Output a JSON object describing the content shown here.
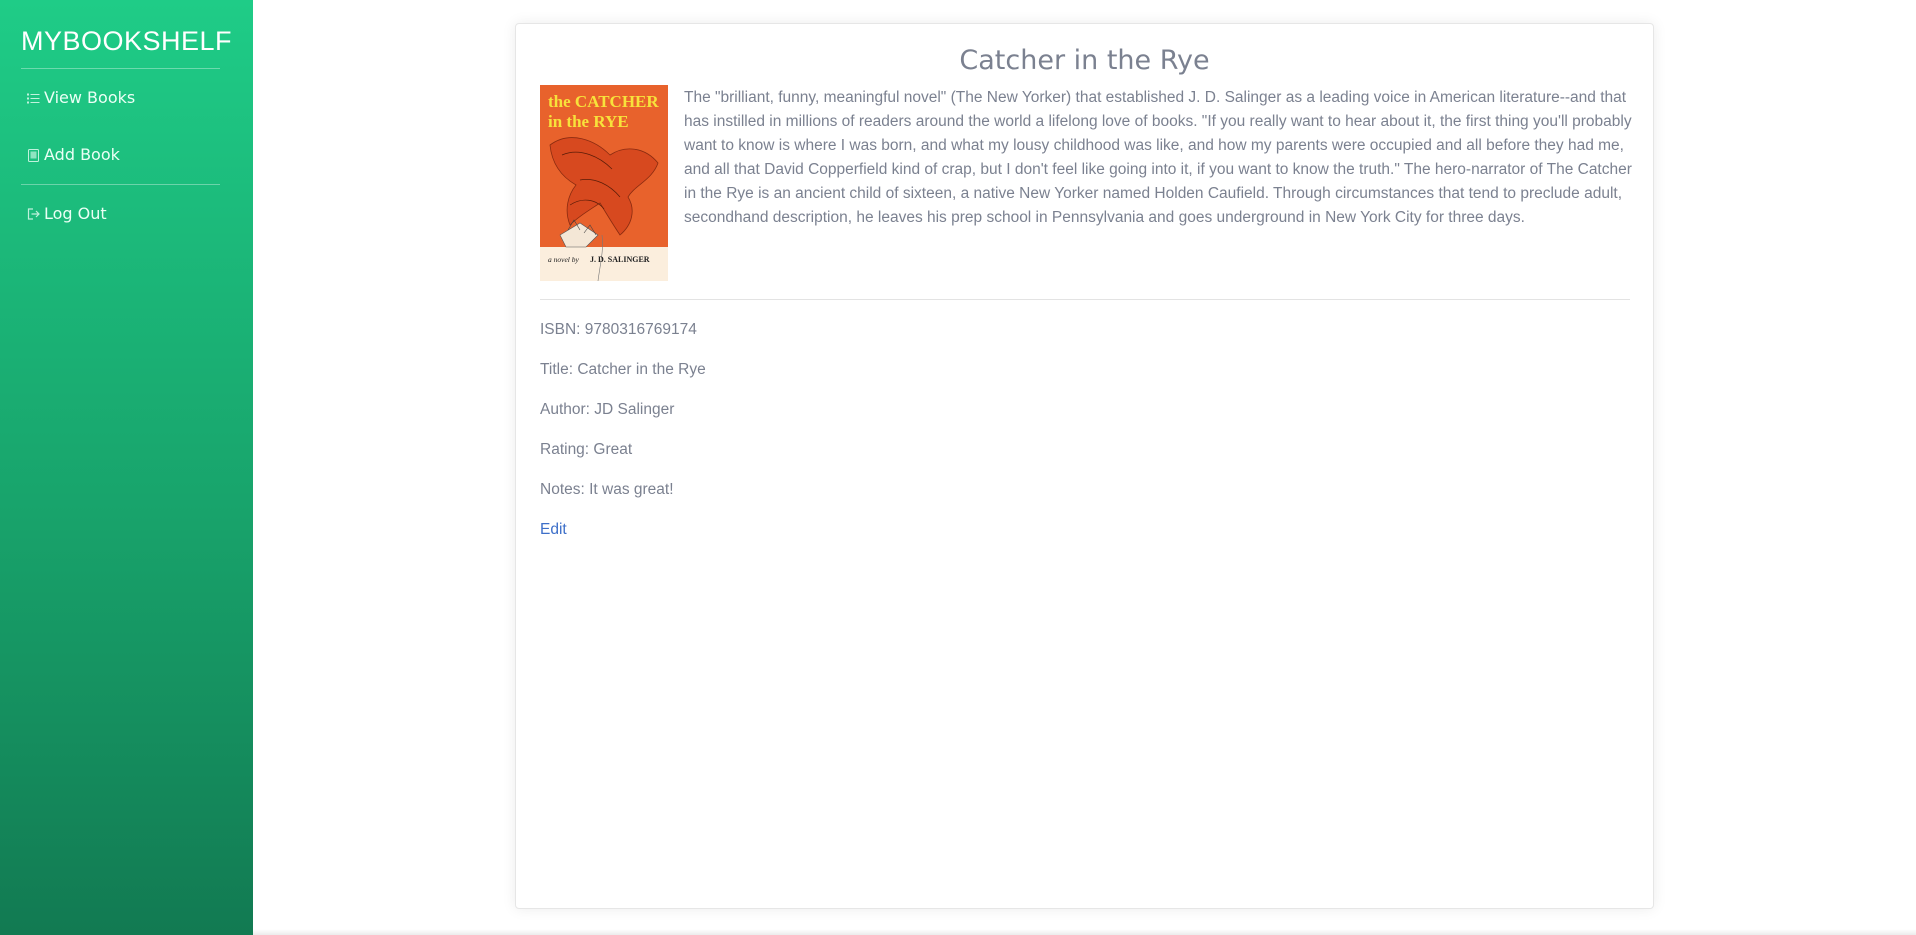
{
  "sidebar": {
    "brand": "MYBOOKSHELF",
    "items": [
      {
        "label": "View Books",
        "icon": "list-icon"
      },
      {
        "label": "Add Book",
        "icon": "book-icon"
      },
      {
        "label": "Log Out",
        "icon": "logout-icon"
      }
    ],
    "background_top": "#1fcc87",
    "background_bottom": "#127a52"
  },
  "book": {
    "heading": "Catcher in the Rye",
    "cover": {
      "title_line1": "the CATCHER",
      "title_line2": "in the RYE",
      "byline": "a novel by",
      "author": "J. D. SALINGER"
    },
    "description": "The \"brilliant, funny, meaningful novel\" (The New Yorker) that established J. D. Salinger as a leading voice in American literature--and that has instilled in millions of readers around the world a lifelong love of books. \"If you really want to hear about it, the first thing you'll probably want to know is where I was born, and what my lousy childhood was like, and how my parents were occupied and all before they had me, and all that David Copperfield kind of crap, but I don't feel like going into it, if you want to know the truth.\" The hero-narrator of The Catcher in the Rye is an ancient child of sixteen, a native New Yorker named Holden Caufield. Through circumstances that tend to preclude adult, secondhand description, he leaves his prep school in Pennsylvania and goes underground in New York City for three days.",
    "isbn": "ISBN: 9780316769174",
    "title": "Title: Catcher in the Rye",
    "author": "Author: JD Salinger",
    "rating": "Rating: Great",
    "notes": "Notes: It was great!",
    "edit_label": "Edit"
  }
}
